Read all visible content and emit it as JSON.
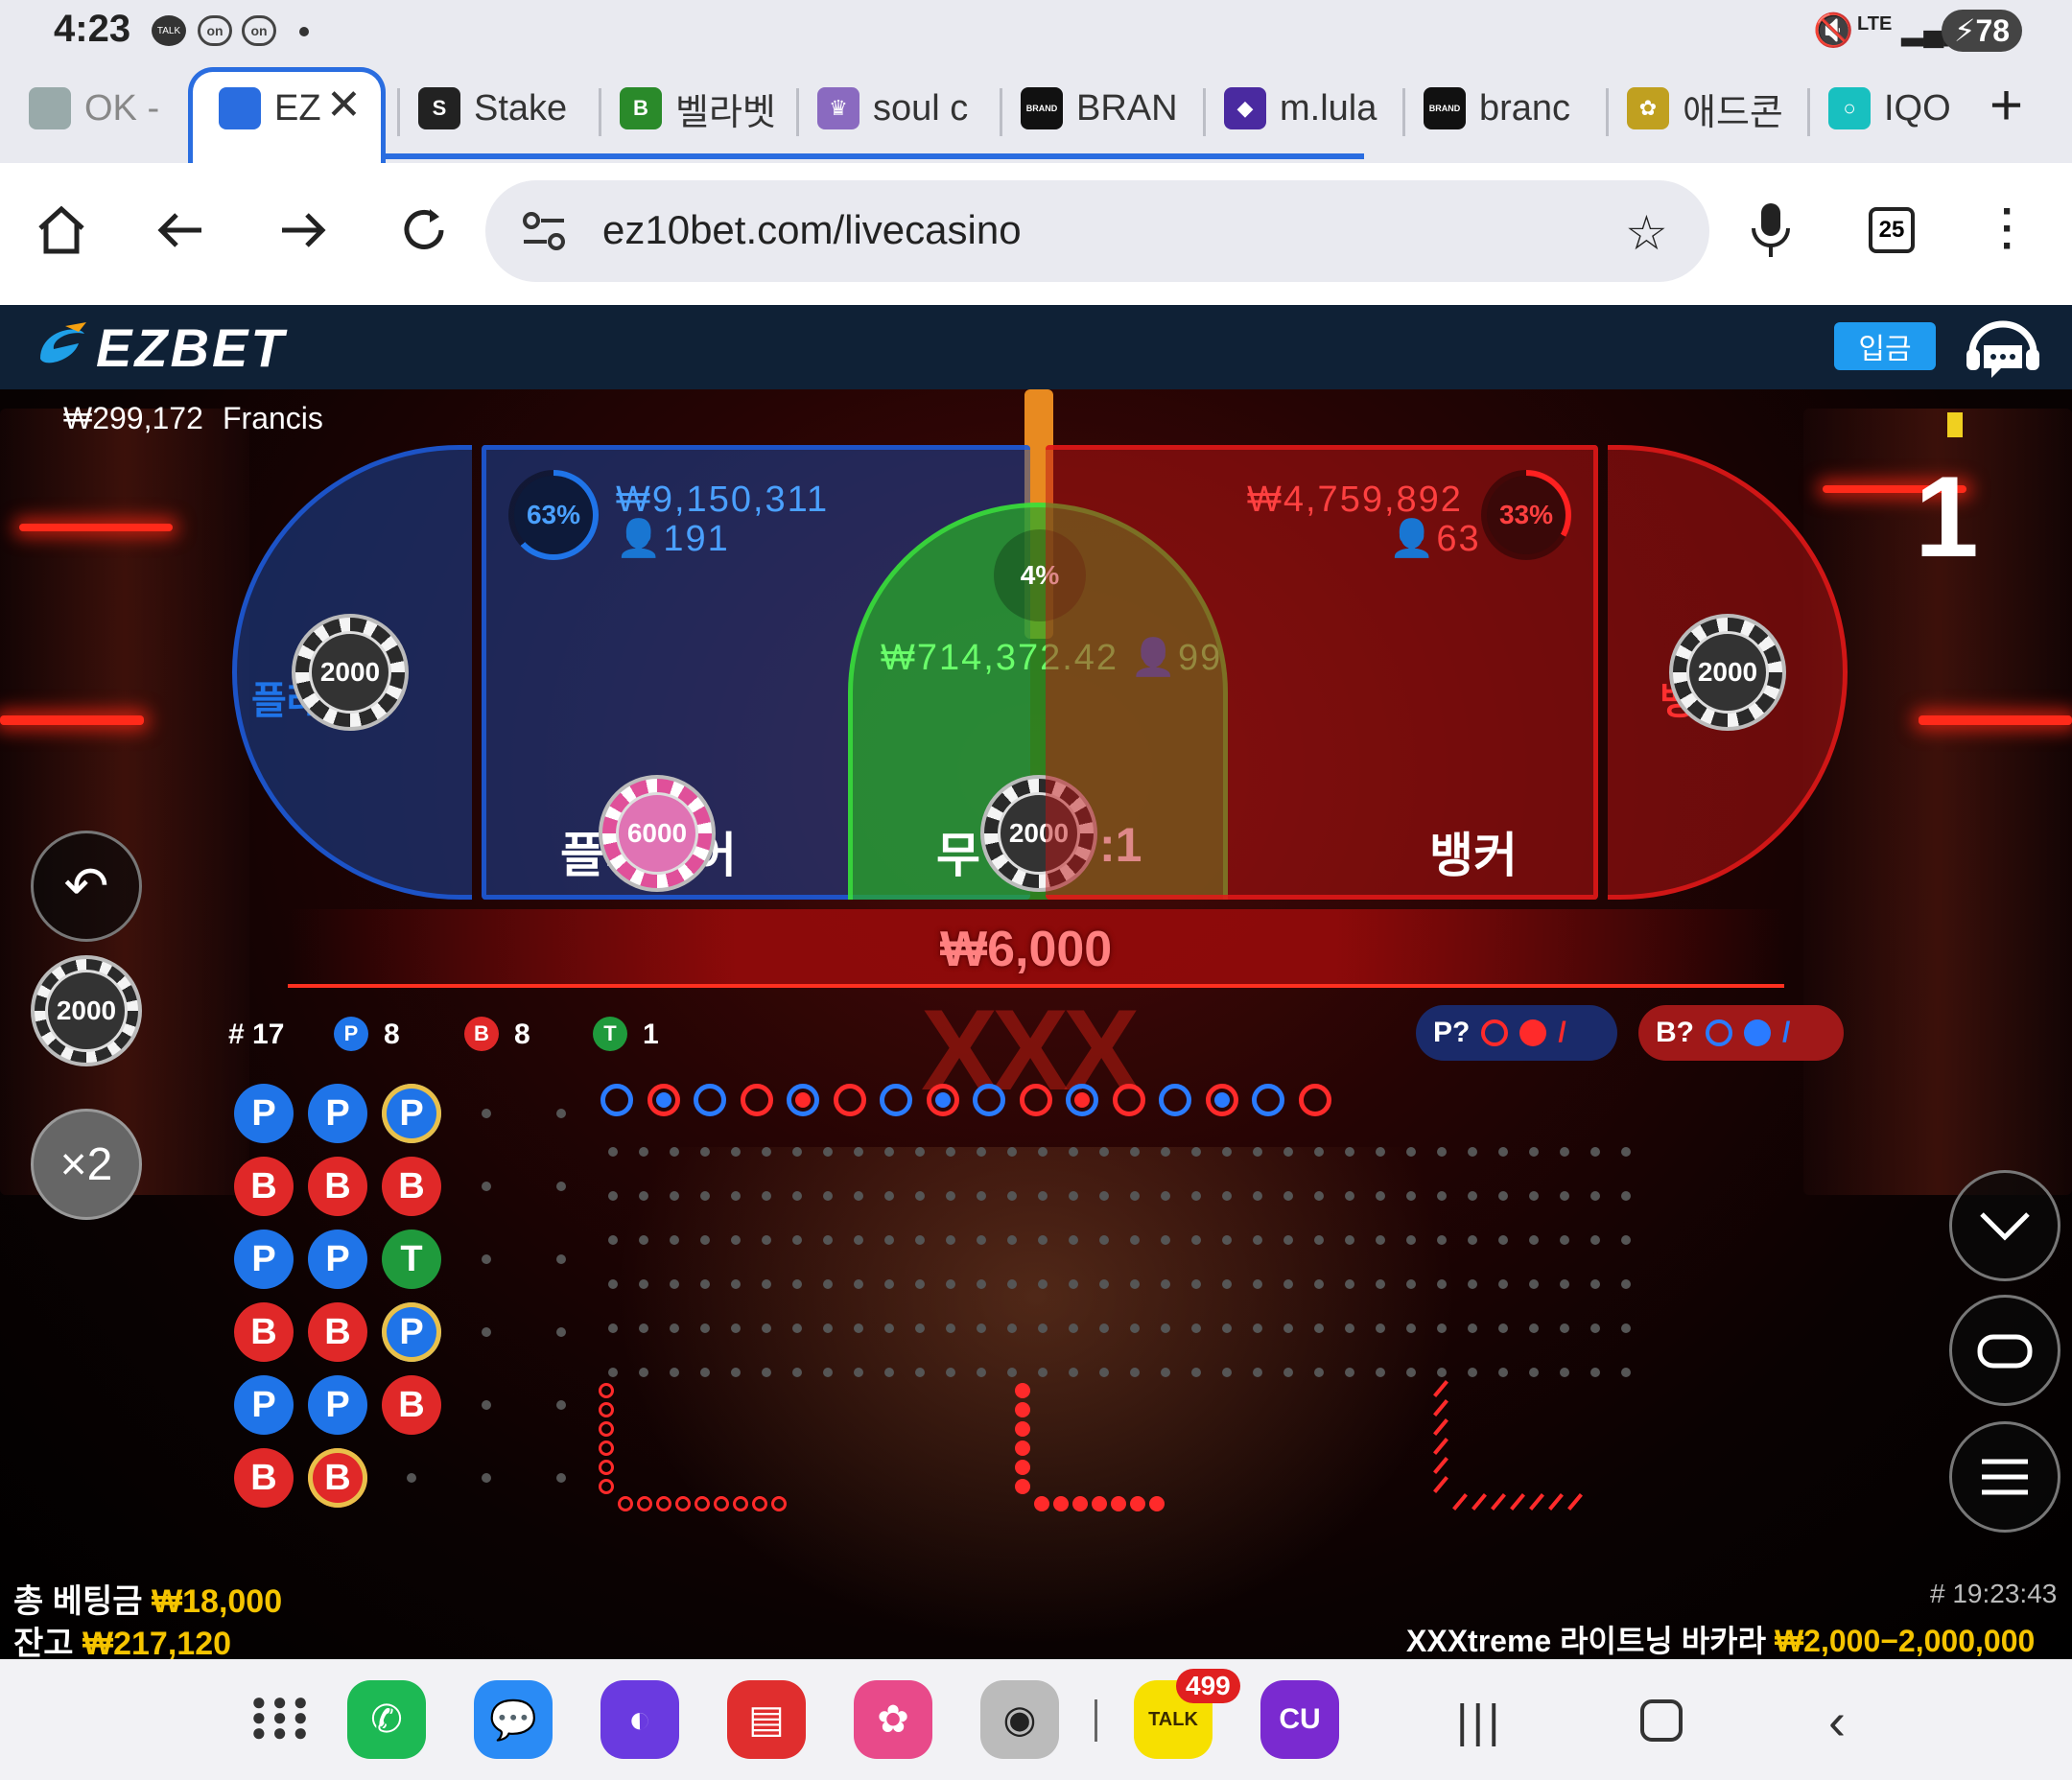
{
  "status": {
    "time": "4:23",
    "battery": "78",
    "talk": "TALK",
    "net": "LTE"
  },
  "tabs": [
    {
      "label": "OK -",
      "icon": "ok-tab-icon",
      "color": "#9aa"
    },
    {
      "label": "EZ",
      "icon": "ezbet-tab-icon",
      "color": "#2a6de0"
    },
    {
      "label": "Stake",
      "icon": "stake-tab-icon",
      "color": "#222",
      "glyph": "S"
    },
    {
      "label": "벨라벳",
      "icon": "bellabet-tab-icon",
      "color": "#2a8a2a",
      "glyph": "B"
    },
    {
      "label": "soul c",
      "icon": "crown-tab-icon",
      "color": "#8a6ac0",
      "glyph": "♛"
    },
    {
      "label": "BRAN",
      "icon": "brand-tab-icon",
      "color": "#111",
      "glyph": "BRAND"
    },
    {
      "label": "m.lula",
      "icon": "lula-tab-icon",
      "color": "#4a2aa0",
      "glyph": "◆"
    },
    {
      "label": "branc",
      "icon": "brand2-tab-icon",
      "color": "#111",
      "glyph": "BRAND"
    },
    {
      "label": "애드콘",
      "icon": "adcon-tab-icon",
      "color": "#c0a020",
      "glyph": "✿"
    },
    {
      "label": "IQO",
      "icon": "iqo-tab-icon",
      "color": "#18c0c0",
      "glyph": "○"
    }
  ],
  "url": "ez10bet.com/livecasino",
  "tab_count": "25",
  "site": {
    "logo": "EZBET",
    "deposit": "입금"
  },
  "player": {
    "balance": "₩299,172",
    "name": "Francis"
  },
  "round_number": "1",
  "zones": {
    "player": {
      "label": "플레이어",
      "pct": "63%",
      "amount": "₩9,150,311",
      "count": "191",
      "chip": "6000",
      "pct_value": 0.63
    },
    "tie": {
      "label": "무",
      "payout": ":1",
      "pct": "4%",
      "amount": "₩714,372.42",
      "count": "99",
      "chip": "2000",
      "pct_value": 0.04
    },
    "banker": {
      "label": "뱅커",
      "pct": "33%",
      "amount": "₩4,759,892",
      "count": "63",
      "pct_value": 0.33
    },
    "player_pair": {
      "label": "플레이어",
      "chip": "2000"
    },
    "banker_pair": {
      "label": "뱅커",
      "chip": "2000"
    }
  },
  "total_bet_strip": "₩6,000",
  "controls": {
    "undo": "↶",
    "chip": "2000",
    "double": "×2"
  },
  "road_stats": {
    "games": "# 17",
    "p_label": "P",
    "p": "8",
    "b_label": "B",
    "b": "8",
    "t_label": "T",
    "t": "1"
  },
  "predict": {
    "p": "P?",
    "b": "B?"
  },
  "bead_road": [
    [
      "P",
      "B",
      "P",
      "B",
      "P",
      "B"
    ],
    [
      "P",
      "B",
      "P",
      "B",
      "P",
      "B"
    ],
    [
      "P",
      "B",
      "T",
      "P",
      "B",
      ""
    ]
  ],
  "big_road_rings": [
    "B",
    "R",
    "B",
    "R",
    "B",
    "R",
    "B",
    "R",
    "B",
    "R",
    "B",
    "R",
    "B",
    "R",
    "B",
    "R"
  ],
  "bottom": {
    "total_bet_label": "총 베팅금",
    "total_bet": "₩18,000",
    "balance_label": "잔고",
    "balance": "₩217,120",
    "game_id": "# 19:23:43",
    "table_name": "XXXtreme 라이트닝 바카라",
    "limits": "₩2,000−2,000,000"
  },
  "nav_badge": "499",
  "talk_app": "TALK"
}
